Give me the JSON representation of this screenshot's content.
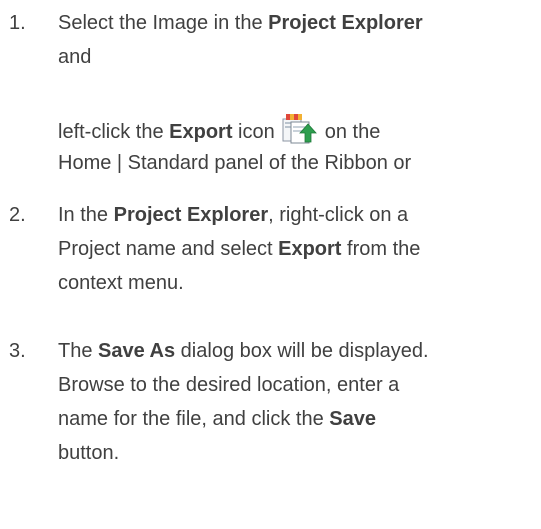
{
  "steps": [
    {
      "number": "1.",
      "line1": {
        "pre": "Select the Image in the ",
        "bold": "Project Explorer"
      },
      "line2": "and",
      "line3": {
        "pre": "left-click the ",
        "bold": "Export",
        "mid": " icon",
        "post": "on the"
      },
      "line4": "Home | Standard panel of the Ribbon or"
    },
    {
      "number": "2.",
      "line1": {
        "pre": "In the ",
        "bold": "Project Explorer",
        "post": ", right-click on a"
      },
      "line2": {
        "pre": "Project name and select ",
        "bold": "Export",
        "post": " from the"
      },
      "line3": "context menu."
    },
    {
      "number": "3.",
      "line1": {
        "pre": "The ",
        "bold": "Save As",
        "post": " dialog box will be displayed."
      },
      "line2": "Browse to the desired location, enter a",
      "line3": {
        "pre": "name for the file, and click the ",
        "bold": "Save"
      },
      "line4": "button."
    }
  ],
  "icons": {
    "export": "export-icon"
  },
  "colors": {
    "text": "#404040",
    "icon_accent": "#2e9e4f"
  }
}
